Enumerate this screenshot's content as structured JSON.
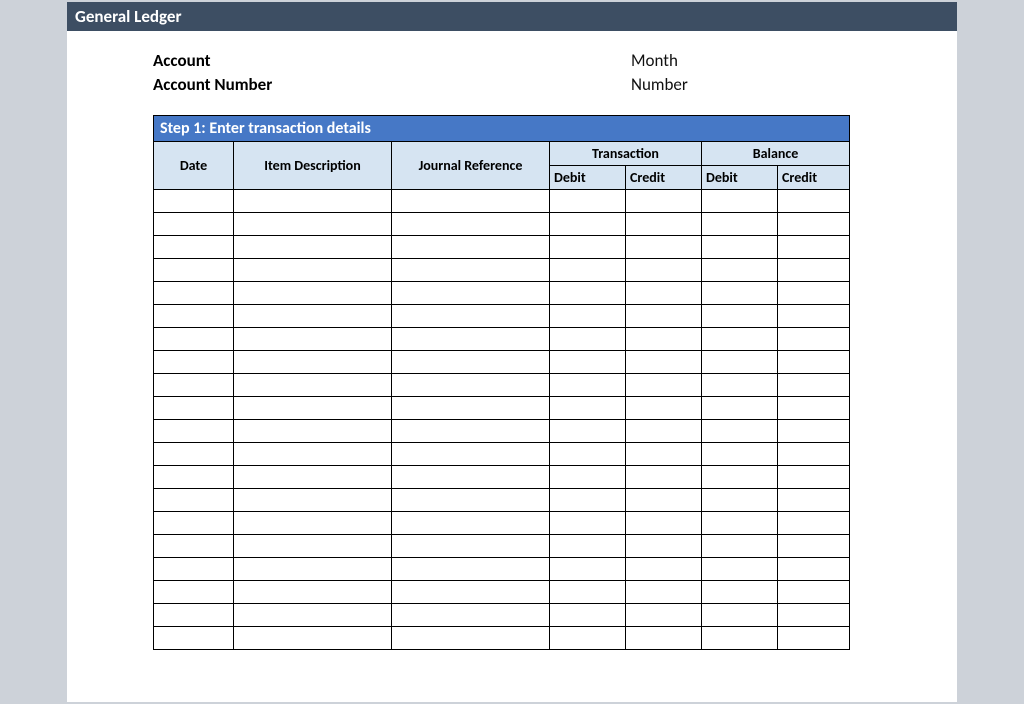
{
  "title": "General Ledger",
  "meta": {
    "left": {
      "account_label": "Account",
      "account_number_label": "Account Number"
    },
    "right": {
      "month_label": "Month",
      "number_label": "Number"
    }
  },
  "step_header": "Step 1: Enter transaction details",
  "group_headers": {
    "blank1": "",
    "blank2": "",
    "blank3": "",
    "transaction": "Transaction",
    "balance": "Balance"
  },
  "column_headers": {
    "date": "Date",
    "item_description": "Item Description",
    "journal_reference": "Journal Reference",
    "trans_debit": "Debit",
    "trans_credit": "Credit",
    "bal_debit": "Debit",
    "bal_credit": "Credit"
  },
  "rows": [
    {
      "date": "",
      "desc": "",
      "ref": "",
      "tdeb": "",
      "tcred": "",
      "bdeb": "",
      "bcred": ""
    },
    {
      "date": "",
      "desc": "",
      "ref": "",
      "tdeb": "",
      "tcred": "",
      "bdeb": "",
      "bcred": ""
    },
    {
      "date": "",
      "desc": "",
      "ref": "",
      "tdeb": "",
      "tcred": "",
      "bdeb": "",
      "bcred": ""
    },
    {
      "date": "",
      "desc": "",
      "ref": "",
      "tdeb": "",
      "tcred": "",
      "bdeb": "",
      "bcred": ""
    },
    {
      "date": "",
      "desc": "",
      "ref": "",
      "tdeb": "",
      "tcred": "",
      "bdeb": "",
      "bcred": ""
    },
    {
      "date": "",
      "desc": "",
      "ref": "",
      "tdeb": "",
      "tcred": "",
      "bdeb": "",
      "bcred": ""
    },
    {
      "date": "",
      "desc": "",
      "ref": "",
      "tdeb": "",
      "tcred": "",
      "bdeb": "",
      "bcred": ""
    },
    {
      "date": "",
      "desc": "",
      "ref": "",
      "tdeb": "",
      "tcred": "",
      "bdeb": "",
      "bcred": ""
    },
    {
      "date": "",
      "desc": "",
      "ref": "",
      "tdeb": "",
      "tcred": "",
      "bdeb": "",
      "bcred": ""
    },
    {
      "date": "",
      "desc": "",
      "ref": "",
      "tdeb": "",
      "tcred": "",
      "bdeb": "",
      "bcred": ""
    },
    {
      "date": "",
      "desc": "",
      "ref": "",
      "tdeb": "",
      "tcred": "",
      "bdeb": "",
      "bcred": ""
    },
    {
      "date": "",
      "desc": "",
      "ref": "",
      "tdeb": "",
      "tcred": "",
      "bdeb": "",
      "bcred": ""
    },
    {
      "date": "",
      "desc": "",
      "ref": "",
      "tdeb": "",
      "tcred": "",
      "bdeb": "",
      "bcred": ""
    },
    {
      "date": "",
      "desc": "",
      "ref": "",
      "tdeb": "",
      "tcred": "",
      "bdeb": "",
      "bcred": ""
    },
    {
      "date": "",
      "desc": "",
      "ref": "",
      "tdeb": "",
      "tcred": "",
      "bdeb": "",
      "bcred": ""
    },
    {
      "date": "",
      "desc": "",
      "ref": "",
      "tdeb": "",
      "tcred": "",
      "bdeb": "",
      "bcred": ""
    },
    {
      "date": "",
      "desc": "",
      "ref": "",
      "tdeb": "",
      "tcred": "",
      "bdeb": "",
      "bcred": ""
    },
    {
      "date": "",
      "desc": "",
      "ref": "",
      "tdeb": "",
      "tcred": "",
      "bdeb": "",
      "bcred": ""
    },
    {
      "date": "",
      "desc": "",
      "ref": "",
      "tdeb": "",
      "tcred": "",
      "bdeb": "",
      "bcred": ""
    },
    {
      "date": "",
      "desc": "",
      "ref": "",
      "tdeb": "",
      "tcred": "",
      "bdeb": "",
      "bcred": ""
    }
  ]
}
